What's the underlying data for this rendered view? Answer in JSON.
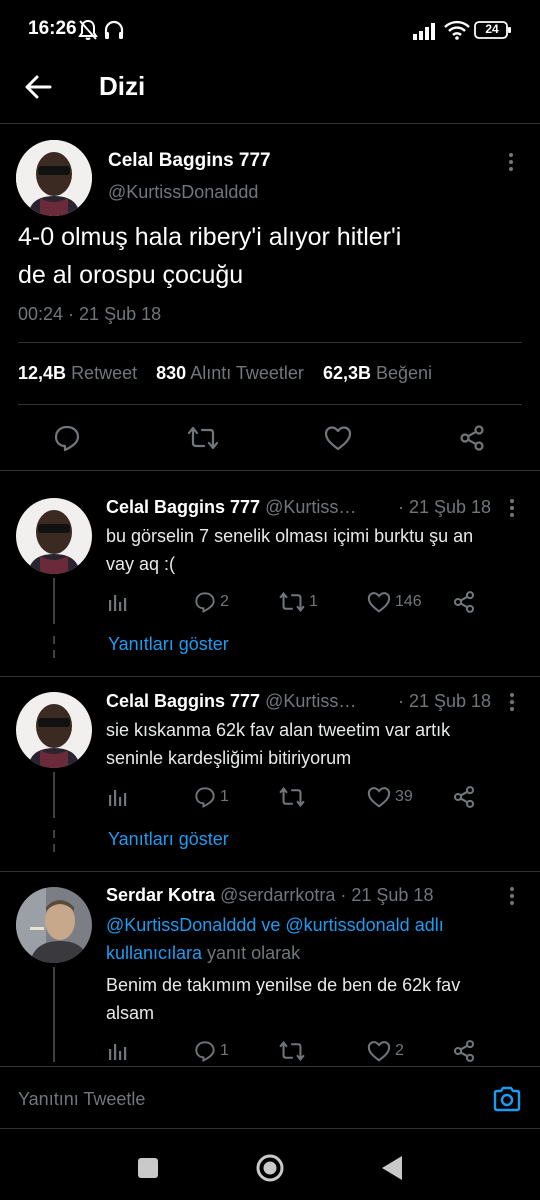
{
  "status_bar": {
    "time": "16:26",
    "battery": "24"
  },
  "header": {
    "title": "Dizi"
  },
  "main_tweet": {
    "name": "Celal Baggins 777",
    "handle": "@KurtissDonalddd",
    "text_line1": "4-0 olmuş hala ribery'i alıyor hitler'i",
    "text_line2": "de al orospu çocuğu",
    "timestamp": "00:24 · 21 Şub 18",
    "stats": {
      "retweets": "12,4B",
      "retweets_label": "Retweet",
      "quotes": "830",
      "quotes_label": "Alıntı Tweetler",
      "likes": "62,3B",
      "likes_label": "Beğeni"
    }
  },
  "replies": [
    {
      "name": "Celal Baggins 777",
      "handle": "@Kurtiss…",
      "date": "· 21 Şub 18",
      "text_line1": "bu görselin 7 senelik olması içimi burktu şu an",
      "text_line2": "vay aq :(",
      "replies": "2",
      "retweets": "1",
      "likes": "146",
      "show_replies": "Yanıtları göster"
    },
    {
      "name": "Celal Baggins 777",
      "handle": "@Kurtiss…",
      "date": "· 21 Şub 18",
      "text_line1": "sie kıskanma 62k fav alan tweetim var artık",
      "text_line2": "seninle kardeşliğimi bitiriyorum",
      "replies": "1",
      "retweets": "",
      "likes": "39",
      "show_replies": "Yanıtları göster"
    },
    {
      "name": "Serdar Kotra",
      "handle": "@serdarrkotra",
      "date": "· 21 Şub 18",
      "reply_to_line1": "@KurtissDonalddd ve @kurtissdonald adlı",
      "reply_to_line2_blue": "kullanıcılara",
      "reply_to_line2_muted": " yanıt olarak",
      "text_line1": "Benim de takımım yenilse de ben de 62k fav",
      "text_line2": "alsam",
      "replies": "1",
      "retweets": "",
      "likes": "2"
    }
  ],
  "compose": {
    "placeholder": "Yanıtını Tweetle"
  },
  "colors": {
    "background": "#000000",
    "accent": "#1d9bf0",
    "muted": "#71767b",
    "divider": "#2f3336"
  }
}
